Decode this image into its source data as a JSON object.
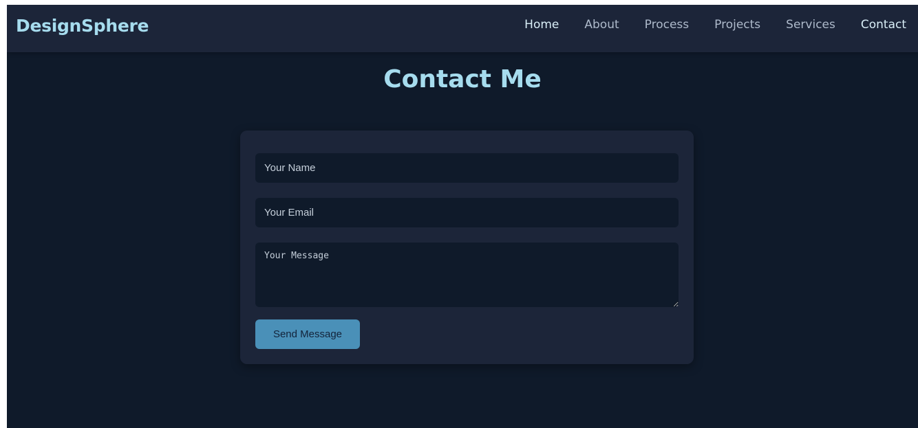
{
  "brand": "DesignSphere",
  "nav": {
    "items": [
      {
        "label": "Home"
      },
      {
        "label": "About"
      },
      {
        "label": "Process"
      },
      {
        "label": "Projects"
      },
      {
        "label": "Services"
      },
      {
        "label": "Contact"
      }
    ],
    "active": "Contact"
  },
  "page": {
    "title": "Contact Me"
  },
  "form": {
    "name_placeholder": "Your Name",
    "email_placeholder": "Your Email",
    "message_placeholder": "Your Message",
    "submit_label": "Send Message"
  },
  "colors": {
    "page_bg": "#0f1a2a",
    "nav_bg": "#1c2539",
    "accent": "#a6dcee",
    "button": "#4a90b8"
  }
}
